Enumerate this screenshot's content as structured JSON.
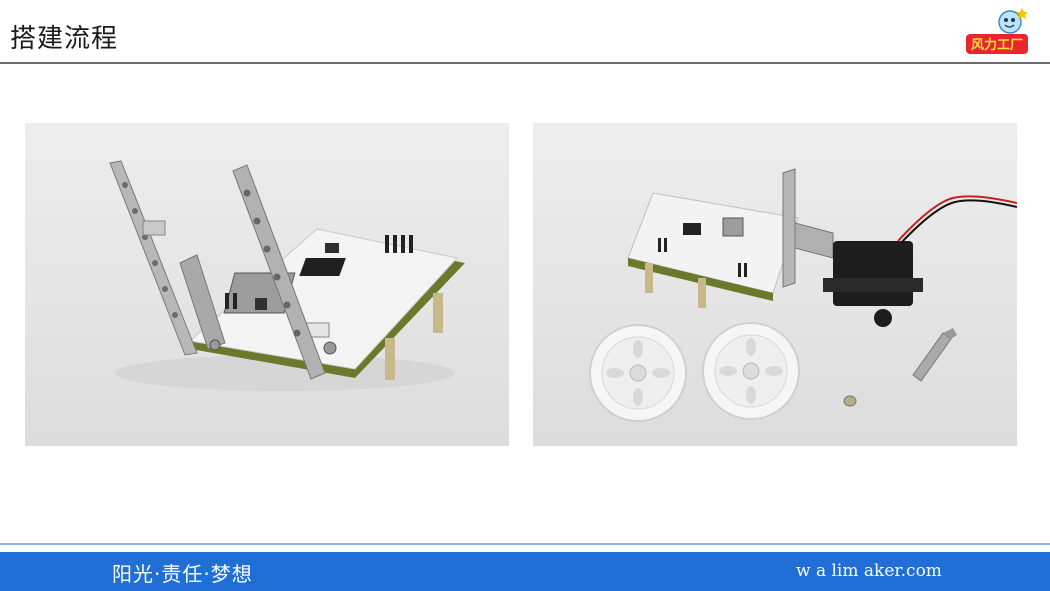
{
  "header": {
    "title": "搭建流程",
    "logo_text": "风力工厂"
  },
  "photos": [
    {
      "name": "assembled-board-with-brackets"
    },
    {
      "name": "parts-board-servo-wheels"
    }
  ],
  "footer": {
    "slogan": "阳光·责任·梦想",
    "website": "w a lim aker.com"
  },
  "colors": {
    "footer_bg": "#1f6fd6",
    "rule": "#6e6e6e"
  }
}
